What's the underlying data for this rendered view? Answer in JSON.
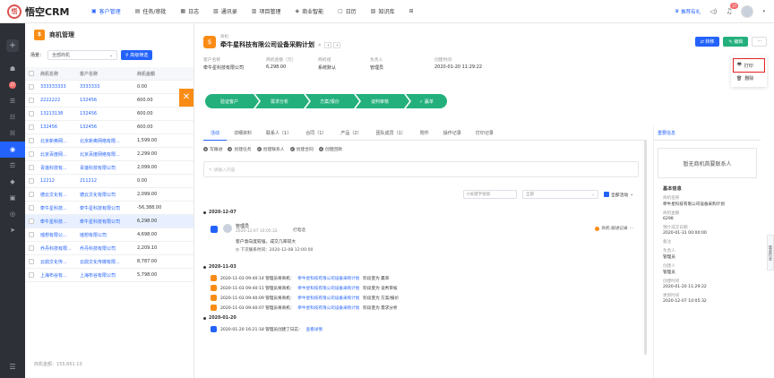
{
  "brand": {
    "logo_glyph": "悟",
    "name": "悟空CRM"
  },
  "nav": [
    {
      "icon": "▣",
      "label": "客户管理",
      "active": true
    },
    {
      "icon": "▤",
      "label": "任务/审批",
      "active": false
    },
    {
      "icon": "▦",
      "label": "日志",
      "active": false
    },
    {
      "icon": "▧",
      "label": "通讯录",
      "active": false
    },
    {
      "icon": "▥",
      "label": "项目管理",
      "active": false
    },
    {
      "icon": "◈",
      "label": "商业智能",
      "active": false
    },
    {
      "icon": "▢",
      "label": "日历",
      "active": false
    },
    {
      "icon": "▨",
      "label": "知识库",
      "active": false
    },
    {
      "icon": "⊞",
      "label": "",
      "active": false
    }
  ],
  "topright": {
    "recommend": "推荐有礼",
    "badge": "27"
  },
  "sidebar": {
    "plus": "+",
    "icons": [
      {
        "name": "dashboard-icon",
        "glyph": "☗",
        "active": false
      },
      {
        "name": "notification-icon",
        "glyph": "27",
        "active": false,
        "dot": true
      },
      {
        "name": "leads-icon",
        "glyph": "☰",
        "active": false
      },
      {
        "name": "customer-icon",
        "glyph": "☷",
        "active": false
      },
      {
        "name": "contacts-icon",
        "glyph": "☵",
        "active": false
      },
      {
        "name": "opportunity-icon",
        "glyph": "◉",
        "active": true
      },
      {
        "name": "contract-icon",
        "glyph": "☲",
        "active": false
      },
      {
        "name": "payment-icon",
        "glyph": "◆",
        "active": false
      },
      {
        "name": "product-icon",
        "glyph": "▣",
        "active": false
      },
      {
        "name": "visit-icon",
        "glyph": "◎",
        "active": false
      },
      {
        "name": "send-icon",
        "glyph": "➤",
        "active": false
      }
    ],
    "bottom": "☰"
  },
  "list": {
    "title": "商机管理",
    "title_glyph": "$",
    "scene_label": "场景：",
    "scene_value": "全部商机",
    "advanced_filter": "高级筛选",
    "headers": [
      "商机名称",
      "客户名称",
      "商机金额"
    ],
    "rows": [
      [
        "333333333",
        "3333333",
        "0.00"
      ],
      [
        "2222222",
        "132456",
        "600.00"
      ],
      [
        "13213136",
        "132456",
        "600.00"
      ],
      [
        "132456",
        "132456",
        "600.00"
      ],
      [
        "北京新奥网...",
        "北京新奥网络有限...",
        "1,599.00"
      ],
      [
        "北京百度网...",
        "北京百度网络有限...",
        "2,299.00"
      ],
      [
        "青莲科技有...",
        "青莲科技有限公司",
        "2,099.00"
      ],
      [
        "12212",
        "211212",
        "0.00"
      ],
      [
        "德云文化有...",
        "德云文化有限公司",
        "2,099.00"
      ],
      [
        "牵牛星科技...",
        "牵牛星科技有限公司",
        "-56,388.00"
      ],
      [
        "牵牛星科技...",
        "牵牛星科技有限公司",
        "6,298.00"
      ],
      [
        "瑶想有限公...",
        "瑶想有限公司",
        "4,698.00"
      ],
      [
        "乔丹科技有限...",
        "乔丹科技有限公司",
        "2,209.10"
      ],
      [
        "云鼎文化传...",
        "云鼎文化传媒有限...",
        "8,787.00"
      ],
      [
        "上海布谷有...",
        "上海布谷有限公司",
        "5,798.00"
      ]
    ],
    "selected_index": 10,
    "footer": "商机金额：155,661.10"
  },
  "detail": {
    "kind": "商机",
    "title": "牵牛星科技有限公司设备采购计划",
    "fields": [
      {
        "k": "客户名称",
        "v": "牵牛星科技有限公司"
      },
      {
        "k": "商机金额（元）",
        "v": "6,298.00"
      },
      {
        "k": "商机组",
        "v": "系统默认"
      },
      {
        "k": "负责人",
        "v": "管理员"
      },
      {
        "k": "创建时间",
        "v": "2020-01-20 11:29:22"
      }
    ],
    "btn_transfer": "⇄ 转移",
    "btn_edit": "✎ 编辑",
    "btn_more": "···",
    "dropdown": [
      {
        "icon": "🖶",
        "label": "打印",
        "highlight": true
      },
      {
        "icon": "🗑",
        "label": "删除",
        "highlight": false
      }
    ],
    "stages": [
      "验证客户",
      "需求分析",
      "方案/报价",
      "谈判审核",
      "✓ 赢单"
    ],
    "tabs": [
      "活动",
      "详细资料",
      "联系人（1）",
      "合同（1）",
      "产品（2）",
      "团队成员（1）",
      "附件",
      "操作记录",
      "打印记录"
    ],
    "actions": [
      "写跟进",
      "创建任务",
      "创建联系人",
      "创建合同",
      "创建回款"
    ],
    "input_placeholder": "请输入内容",
    "filter_search": "关键字搜索",
    "filter_all": "全部",
    "all_activities": "全部活动",
    "timeline": {
      "date1": "2020-12-07",
      "card": {
        "name": "管理员",
        "time": "2020-12-07 10:05:32",
        "tag": "打电话",
        "text": "客户意向度较强，成交几率较大",
        "next": "下次联系时间：2020-12-08 12:00:00",
        "right": "商机-跟进记录"
      },
      "date2": "2020-11-03",
      "logs": [
        {
          "pre": "2020-11-03 09:40:14 管理员将商机：",
          "link": "牵牛星科技有限公司设备采购计划",
          "post": " 阶段变为 赢单"
        },
        {
          "pre": "2020-11-03 09:40:11 管理员将商机：",
          "link": "牵牛星科技有限公司设备采购计划",
          "post": " 阶段变为 谈判审核"
        },
        {
          "pre": "2020-11-03 09:40:09 管理员将商机：",
          "link": "牵牛星科技有限公司设备采购计划",
          "post": " 阶段变为 方案/报价"
        },
        {
          "pre": "2020-11-03 09:40:07 管理员将商机：",
          "link": "牵牛星科技有限公司设备采购计划",
          "post": " 阶段变为 需求分析"
        }
      ],
      "date3": "2020-01-20",
      "log3": {
        "pre": "2020-01-20 16:21:18 管理员创建了日志：",
        "link": "查看详情"
      }
    },
    "right_panel": {
      "tab": "重要信息",
      "empty_contact": "暂无商机首要联系人",
      "basic_info": "基本信息",
      "items": [
        {
          "k": "商机名称",
          "v": "牵牛星科技有限公司设备采购计划"
        },
        {
          "k": "商机金额",
          "v": "6298"
        },
        {
          "k": "预计成交日期",
          "v": "2020-01-31 00:00:00"
        },
        {
          "k": "备注",
          "v": ""
        },
        {
          "k": "负责人",
          "v": "管理员"
        },
        {
          "k": "创建人",
          "v": "管理员"
        },
        {
          "k": "创建时间",
          "v": "2020-01-20 11:29:22"
        },
        {
          "k": "更新时间",
          "v": "2020-12-07 10:05:32"
        }
      ],
      "edge_label": "重要信息"
    }
  }
}
